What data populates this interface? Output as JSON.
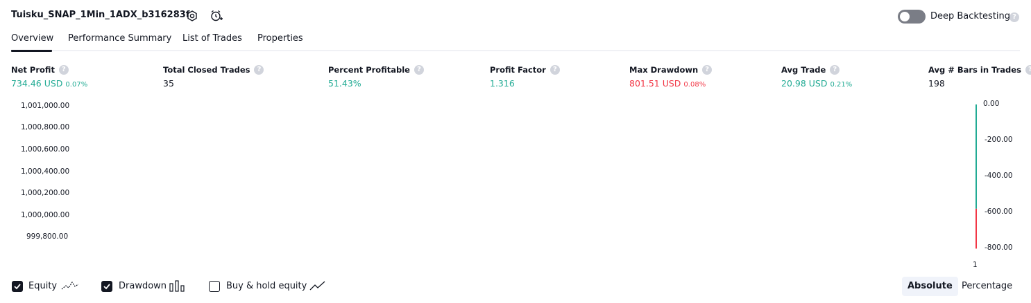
{
  "header": {
    "title": "Tuisku_SNAP_1Min_1ADX_b316283f",
    "deep_backtesting_label": "Deep Backtesting",
    "help_glyph": "?"
  },
  "tabs": [
    {
      "label": "Overview",
      "active": true
    },
    {
      "label": "Performance Summary",
      "active": false
    },
    {
      "label": "List of Trades",
      "active": false
    },
    {
      "label": "Properties",
      "active": false
    }
  ],
  "metrics": {
    "net_profit": {
      "label": "Net Profit",
      "value": "734.46 USD",
      "pct": "0.07%"
    },
    "total_closed_trades": {
      "label": "Total Closed Trades",
      "value": "35"
    },
    "percent_profitable": {
      "label": "Percent Profitable",
      "value": "51.43%"
    },
    "profit_factor": {
      "label": "Profit Factor",
      "value": "1.316"
    },
    "max_drawdown": {
      "label": "Max Drawdown",
      "value": "801.51 USD",
      "pct": "0.08%"
    },
    "avg_trade": {
      "label": "Avg Trade",
      "value": "20.98 USD",
      "pct": "0.21%"
    },
    "avg_bars": {
      "label": "Avg # Bars in Trades",
      "value": "198"
    }
  },
  "chart_data": {
    "type": "bar",
    "title": "",
    "left_axis_ticks": [
      "1,001,000.00",
      "1,000,800.00",
      "1,000,600.00",
      "1,000,400.00",
      "1,000,200.00",
      "1,000,000.00",
      "999,800.00"
    ],
    "right_axis_ticks": [
      "0.00",
      "-200.00",
      "-400.00",
      "-600.00",
      "-800.00"
    ],
    "right_ylim": [
      -800,
      0
    ],
    "categories": [
      "1"
    ],
    "x_tick_label": "1",
    "drawdown_bar": {
      "segments": [
        {
          "from": 0,
          "to": -580,
          "color": "#22ab94"
        },
        {
          "from": -580,
          "to": -801.51,
          "color": "#f23645"
        }
      ]
    }
  },
  "legend": {
    "equity": {
      "label": "Equity",
      "checked": true
    },
    "drawdown": {
      "label": "Drawdown",
      "checked": true
    },
    "buy_hold": {
      "label": "Buy & hold equity",
      "checked": false
    }
  },
  "view_modes": {
    "absolute": "Absolute",
    "percentage": "Percentage",
    "selected": "Absolute"
  },
  "colors": {
    "green": "#22ab94",
    "red": "#f23645",
    "text": "#131722"
  }
}
